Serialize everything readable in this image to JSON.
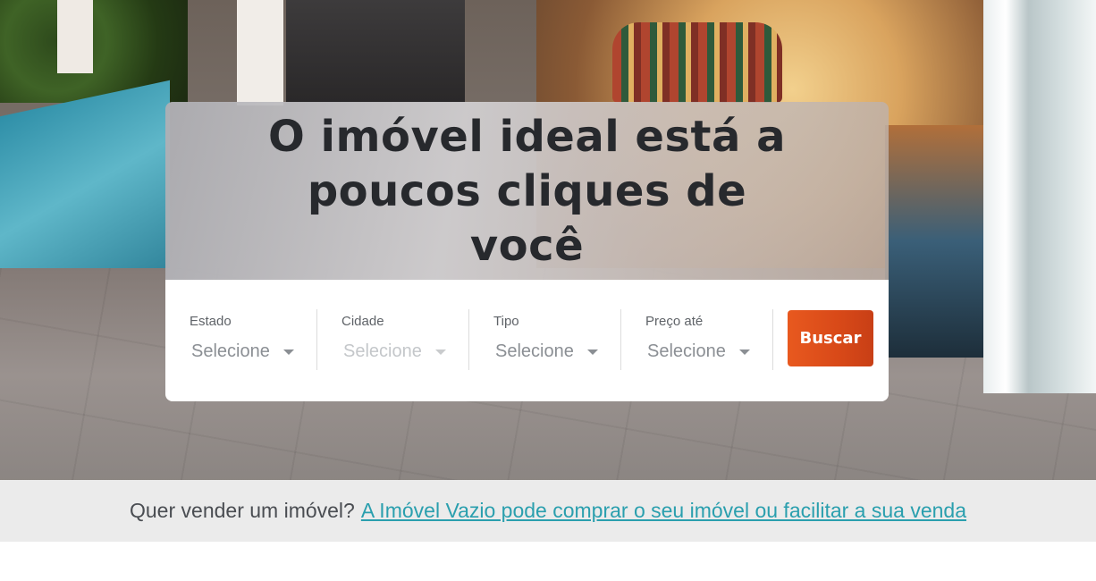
{
  "hero": {
    "headline": "O imóvel ideal está a poucos cliques de você"
  },
  "search": {
    "fields": [
      {
        "label": "Estado",
        "value": "Selecione",
        "enabled": true
      },
      {
        "label": "Cidade",
        "value": "Selecione",
        "enabled": false
      },
      {
        "label": "Tipo",
        "value": "Selecione",
        "enabled": true
      },
      {
        "label": "Preço até",
        "value": "Selecione",
        "enabled": true
      }
    ],
    "button_label": "Buscar"
  },
  "banner": {
    "question": "Quer vender um imóvel?",
    "link_text": "A Imóvel Vazio pode comprar o seu imóvel ou facilitar a sua venda"
  },
  "colors": {
    "accent": "#e35420",
    "link": "#2a9fae",
    "banner_bg": "#ebebeb"
  },
  "icons": {
    "dropdown": "chevron-down-icon"
  }
}
